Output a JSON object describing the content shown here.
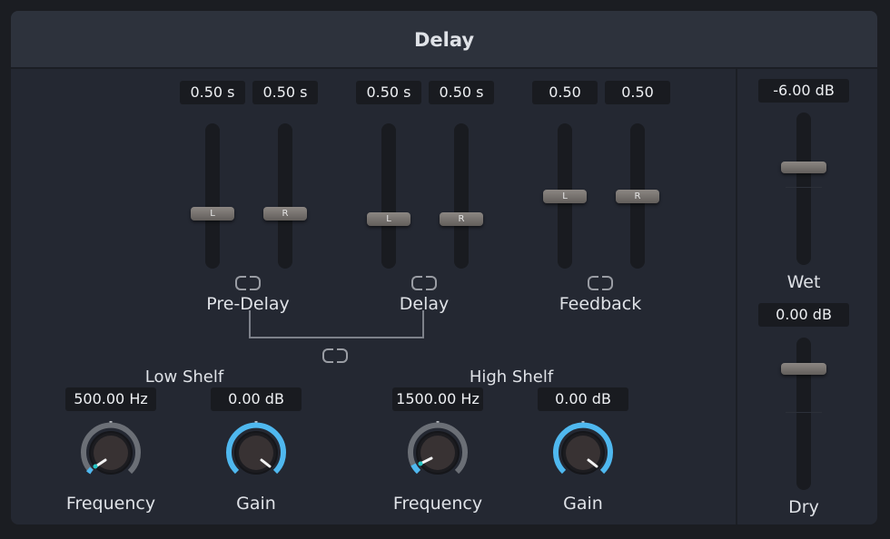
{
  "title": "Delay",
  "pre_delay": {
    "label": "Pre-Delay",
    "left_value": "0.50 s",
    "right_value": "0.50 s",
    "left_handle": "L",
    "right_handle": "R"
  },
  "delay": {
    "label": "Delay",
    "left_value": "0.50 s",
    "right_value": "0.50 s",
    "left_handle": "L",
    "right_handle": "R"
  },
  "feedback": {
    "label": "Feedback",
    "left_value": "0.50",
    "right_value": "0.50",
    "left_handle": "L",
    "right_handle": "R"
  },
  "wet": {
    "label": "Wet",
    "value": "-6.00 dB"
  },
  "dry": {
    "label": "Dry",
    "value": "0.00 dB"
  },
  "low_shelf": {
    "label": "Low Shelf",
    "frequency_value": "500.00 Hz",
    "frequency_label": "Frequency",
    "gain_value": "0.00 dB",
    "gain_label": "Gain"
  },
  "high_shelf": {
    "label": "High Shelf",
    "frequency_value": "1500.00 Hz",
    "frequency_label": "Frequency",
    "gain_value": "0.00 dB",
    "gain_label": "Gain"
  },
  "colors": {
    "accent": "#4fb8ef",
    "indicator_teal": "#27c6c6",
    "panel": "#242832",
    "header": "#2d323c",
    "value_box": "#191b20",
    "handle": "#7a7470"
  },
  "icons": {
    "link": "link-icon"
  }
}
